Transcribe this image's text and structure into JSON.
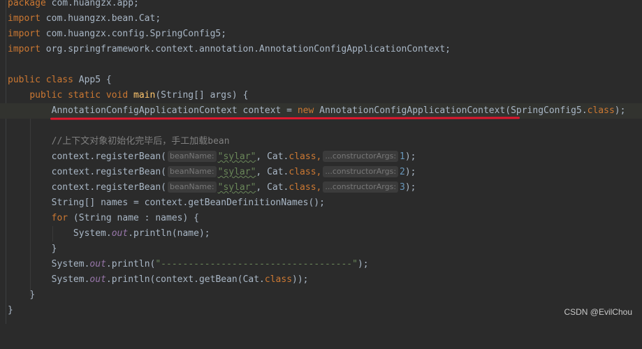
{
  "lines": [
    {
      "parts": [
        {
          "t": "package com.huangzx.app;",
          "c": "kw-mixed-package"
        }
      ]
    },
    {
      "parts": [
        {
          "t": "import com.huangzx.bean.Cat;"
        }
      ]
    },
    {
      "parts": [
        {
          "t": "import com.huangzx.config.SpringConfig5;"
        }
      ]
    },
    {
      "parts": [
        {
          "t": "import org.springframework.context.annotation.AnnotationConfigApplicationContext;"
        }
      ]
    },
    {
      "parts": []
    },
    {
      "parts": [
        {
          "t": "public class App5 {"
        }
      ]
    },
    {
      "parts": [
        {
          "t": "    public static void main(String[] args) {"
        }
      ]
    },
    {
      "parts": [
        {
          "t": "        AnnotationConfigApplicationContext context = new AnnotationConfigApplicationContext(SpringConfig5.class);"
        }
      ]
    },
    {
      "parts": []
    },
    {
      "parts": [
        {
          "t": "        //上下文对象初始化完毕后，手工加载bean"
        }
      ]
    },
    {
      "parts": [
        {
          "t": "        context.registerBean( beanName: \"sylar\", Cat.class, ...constructorArgs: 1);"
        }
      ]
    },
    {
      "parts": [
        {
          "t": "        context.registerBean( beanName: \"sylar\", Cat.class, ...constructorArgs: 2);"
        }
      ]
    },
    {
      "parts": [
        {
          "t": "        context.registerBean( beanName: \"sylar\", Cat.class, ...constructorArgs: 3);"
        }
      ]
    },
    {
      "parts": [
        {
          "t": "        String[] names = context.getBeanDefinitionNames();"
        }
      ]
    },
    {
      "parts": [
        {
          "t": "        for (String name : names) {"
        }
      ]
    },
    {
      "parts": [
        {
          "t": "            System.out.println(name);"
        }
      ]
    },
    {
      "parts": [
        {
          "t": "        }"
        }
      ]
    },
    {
      "parts": [
        {
          "t": "        System.out.println(\"-----------------------------------\");"
        }
      ]
    },
    {
      "parts": [
        {
          "t": "        System.out.println(context.getBean(Cat.class));"
        }
      ]
    },
    {
      "parts": [
        {
          "t": "    }"
        }
      ]
    },
    {
      "parts": [
        {
          "t": "}"
        }
      ]
    }
  ],
  "code": {
    "l0_kw": "package",
    "l0_rest": " com.huangzx.app;",
    "l1_kw": "import",
    "l1_rest": " com.huangzx.bean.Cat;",
    "l2_kw": "import",
    "l2_rest": " com.huangzx.config.SpringConfig5;",
    "l3_kw": "import",
    "l3_rest": " org.springframework.context.annotation.AnnotationConfigApplicationContext;",
    "l5_kw": "public class",
    "l5_rest": " App5 {",
    "l6_kw": "public static void",
    "l6_fn": "main",
    "l6_rest": "(String[] args) {",
    "l7_a": "AnnotationConfigApplicationContext context = ",
    "l7_kw": "new",
    "l7_b": " AnnotationConfigApplicationContext(SpringConfig5.",
    "l7_kw2": "class",
    "l7_c": ");",
    "l9_comment": "//上下文对象初始化完毕后，手工加载bean",
    "reg_call": "context.registerBean(",
    "hint_bean_name": "beanName:",
    "reg_str": "\"sylar\"",
    "reg_mid": ", Cat.",
    "reg_kw": "class",
    "reg_comma": ",",
    "hint_ctor_args": "...constructorArgs:",
    "reg_arg1": "1",
    "reg_arg2": "2",
    "reg_arg3": "3",
    "reg_end": ");",
    "l13": "String[] names = context.getBeanDefinitionNames();",
    "l14_kw": "for",
    "l14_rest": " (String name : names) {",
    "sys": "System.",
    "out": "out",
    "l15_rest": ".println(name);",
    "close_brace": "}",
    "l17_a": ".println(",
    "l17_str": "\"-----------------------------------\"",
    "l17_b": ");",
    "l18_a": ".println(context.getBean(Cat.",
    "l18_kw": "class",
    "l18_b": "));"
  },
  "watermark": "CSDN @EvilChou",
  "colors": {
    "background": "#2b2b2b",
    "keyword": "#cc7832",
    "function": "#ffc66d",
    "string": "#6a8759",
    "comment": "#808080",
    "field": "#9876aa",
    "text": "#a9b7c6",
    "annotation_underline": "#e0182f"
  }
}
